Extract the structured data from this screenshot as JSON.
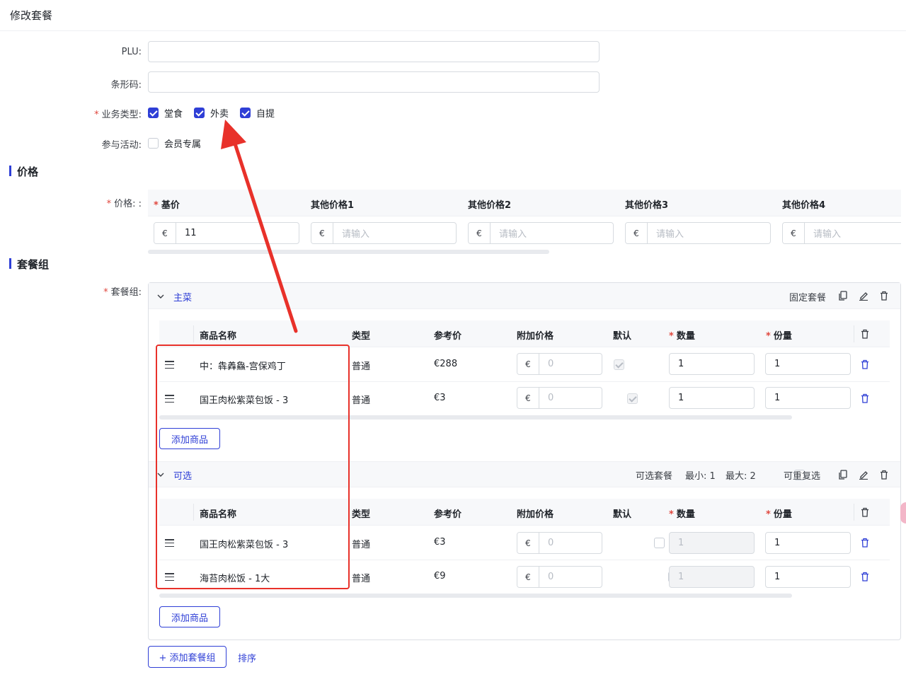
{
  "page": {
    "title": "修改套餐"
  },
  "form": {
    "plu_label": "PLU:",
    "barcode_label": "条形码:",
    "business_type_label": "业务类型:",
    "business_types": [
      {
        "label": "堂食",
        "checked": true
      },
      {
        "label": "外卖",
        "checked": true
      },
      {
        "label": "自提",
        "checked": true
      }
    ],
    "activity_label": "参与活动:",
    "activity_option": {
      "label": "会员专属",
      "checked": false
    }
  },
  "price_section": {
    "title": "价格",
    "field_label": "价格:  :",
    "columns": [
      {
        "label": "基价",
        "required": true,
        "currency": "€",
        "value": "11",
        "placeholder": ""
      },
      {
        "label": "其他价格1",
        "required": false,
        "currency": "€",
        "value": "",
        "placeholder": "请输入"
      },
      {
        "label": "其他价格2",
        "required": false,
        "currency": "€",
        "value": "",
        "placeholder": "请输入"
      },
      {
        "label": "其他价格3",
        "required": false,
        "currency": "€",
        "value": "",
        "placeholder": "请输入"
      },
      {
        "label": "其他价格4",
        "required": false,
        "currency": "€",
        "value": "",
        "placeholder": "请输入"
      }
    ]
  },
  "combo_section": {
    "title": "套餐组",
    "field_label": "套餐组:",
    "table_headers": {
      "name": "商品名称",
      "type": "类型",
      "ref_price": "参考价",
      "extra_price": "附加价格",
      "default": "默认",
      "quantity": "数量",
      "portion": "份量"
    },
    "groups": [
      {
        "name": "主菜",
        "mode": "固定套餐",
        "items": [
          {
            "name": "中：犇羴鱻-宫保鸡丁",
            "type": "普通",
            "ref_price": "€288",
            "currency": "€",
            "extra": "0",
            "default": true,
            "quantity": "1",
            "portion": "1"
          },
          {
            "name": "国王肉松紫菜包饭 - 3",
            "type": "普通",
            "ref_price": "€3",
            "currency": "€",
            "extra": "0",
            "default": true,
            "quantity": "1",
            "portion": "1"
          }
        ],
        "add_button": "添加商品"
      },
      {
        "name": "可选",
        "mode": "可选套餐",
        "min": "最小: 1",
        "max": "最大: 2",
        "repeat_label": "可重复选",
        "items": [
          {
            "name": "国王肉松紫菜包饭 - 3",
            "type": "普通",
            "ref_price": "€3",
            "currency": "€",
            "extra": "0",
            "default": false,
            "quantity": "1",
            "portion": "1"
          },
          {
            "name": "海苔肉松饭 - 1大",
            "type": "普通",
            "ref_price": "€9",
            "currency": "€",
            "extra": "0",
            "default": false,
            "quantity": "1",
            "portion": "1"
          }
        ],
        "add_button": "添加商品"
      }
    ],
    "add_group_button": "+ 添加套餐组",
    "sort_link": "排序"
  },
  "colors": {
    "accent": "#2f3fd6",
    "required": "#e0473e",
    "annotation": "#e8312a"
  }
}
